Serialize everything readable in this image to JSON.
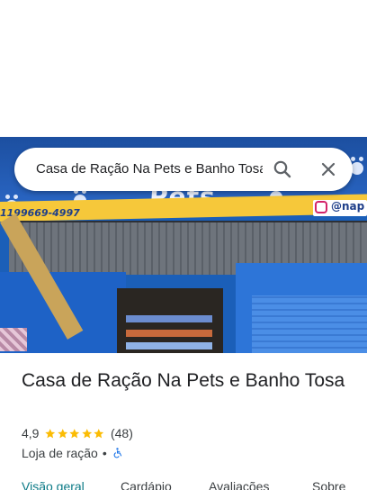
{
  "search": {
    "value": "Casa de Ração Na Pets e Banho Tosa"
  },
  "photo": {
    "sign_text": "Pets",
    "phone_text": "1199669-4997",
    "instagram_handle": "@nap"
  },
  "place": {
    "name": "Casa de Ração Na Pets e Banho Tosa",
    "rating": "4,9",
    "stars": 5,
    "review_count": "(48)",
    "category": "Loja de ração",
    "separator": "•"
  },
  "tabs": [
    {
      "label": "Visão geral",
      "active": true
    },
    {
      "label": "Cardápio",
      "active": false
    },
    {
      "label": "Avaliações",
      "active": false
    },
    {
      "label": "Sobre",
      "active": false
    }
  ],
  "colors": {
    "accent": "#0b7a86",
    "star": "#fbbc04",
    "accessibility": "#1a73e8"
  },
  "icons": [
    "search-icon",
    "close-icon",
    "star-icon",
    "wheelchair-icon"
  ]
}
